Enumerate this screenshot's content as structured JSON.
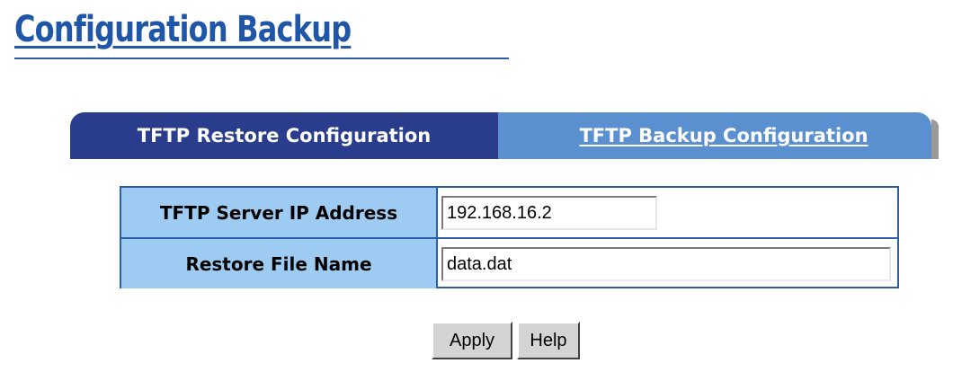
{
  "page": {
    "title": "Configuration Backup"
  },
  "tabs": [
    {
      "label": "TFTP Restore Configuration",
      "active": true
    },
    {
      "label": "TFTP Backup Configuration",
      "active": false
    }
  ],
  "form": {
    "server_ip": {
      "label": "TFTP Server IP Address",
      "value": "192.168.16.2"
    },
    "file_name": {
      "label": "Restore File Name",
      "value": "data.dat"
    }
  },
  "buttons": {
    "apply_label": "Apply",
    "help_label": "Help"
  },
  "colors": {
    "title": "#1f56a8",
    "active_tab": "#2a3d8c",
    "inactive_tab": "#5a8fd0",
    "label_cell": "#9ecbf2",
    "border": "#2c5ea8"
  }
}
